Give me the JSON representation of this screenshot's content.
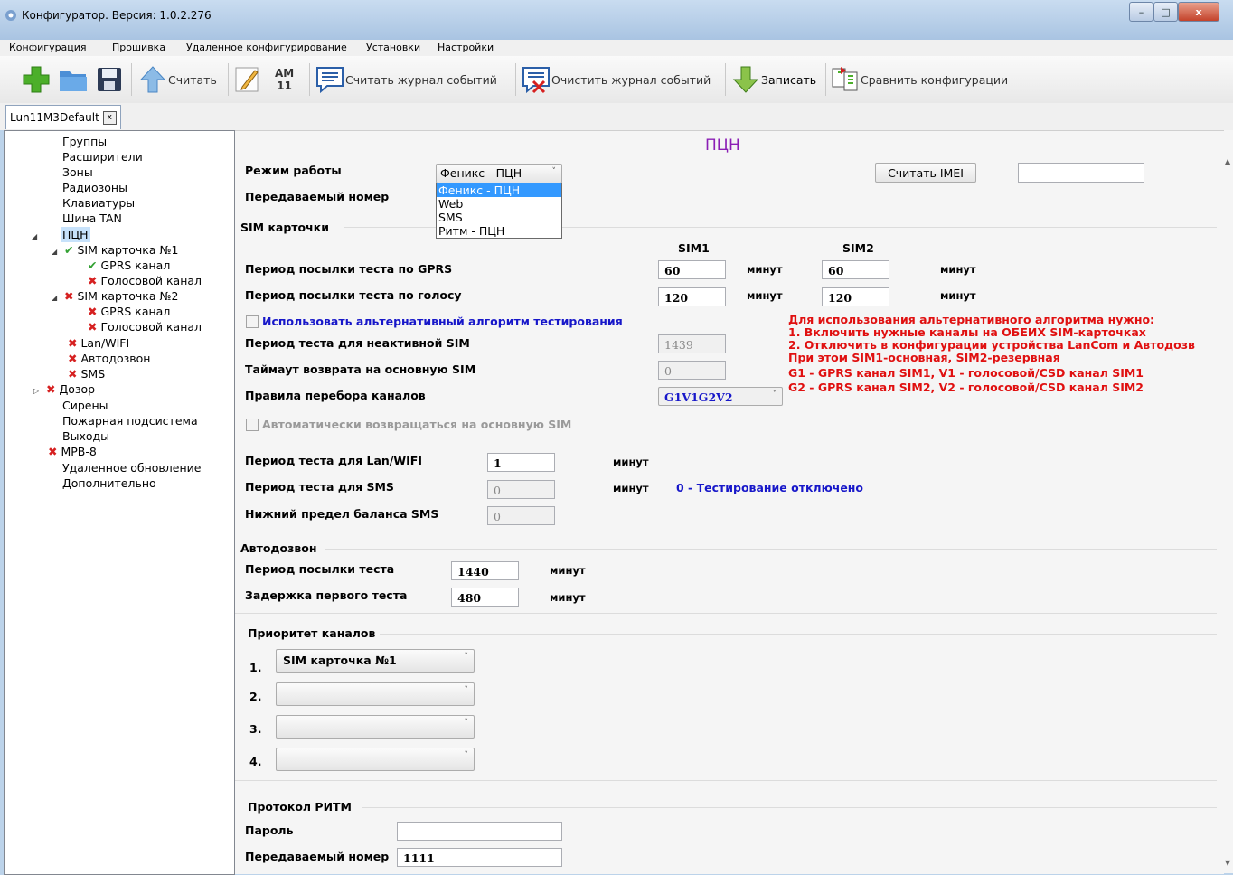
{
  "window": {
    "title": "Конфигуратор. Версия: 1.0.2.276",
    "min": "–",
    "max": "□",
    "close": "x"
  },
  "menu": [
    "Конфигурация",
    "Прошивка",
    "Удаленное конфигурирование",
    "Установки",
    "Настройки"
  ],
  "toolbar": {
    "read": "Считать",
    "am_top": "AM",
    "am_bottom": "11",
    "read_log": "Считать журнал событий",
    "clear_log": "Очистить журнал событий",
    "write": "Записать",
    "compare": "Сравнить конфигурации"
  },
  "tab": {
    "name": "Lun11M3Default",
    "close": "x"
  },
  "tree": [
    {
      "label": "Группы",
      "mark": ""
    },
    {
      "label": "Расширители",
      "mark": ""
    },
    {
      "label": "Зоны",
      "mark": ""
    },
    {
      "label": "Радиозоны",
      "mark": ""
    },
    {
      "label": "Клавиатуры",
      "mark": ""
    },
    {
      "label": "Шина TAN",
      "mark": ""
    },
    {
      "label": "ПЦН",
      "mark": ""
    },
    {
      "label": "SIM карточка №1",
      "mark": "✔"
    },
    {
      "label": "GPRS канал",
      "mark": "✔"
    },
    {
      "label": "Голосовой канал",
      "mark": "✖"
    },
    {
      "label": "SIM карточка №2",
      "mark": "✖"
    },
    {
      "label": "GPRS канал",
      "mark": "✖"
    },
    {
      "label": "Голосовой канал",
      "mark": "✖"
    },
    {
      "label": "Lan/WIFI",
      "mark": "✖"
    },
    {
      "label": "Автодозвон",
      "mark": "✖"
    },
    {
      "label": "SMS",
      "mark": "✖"
    },
    {
      "label": "Дозор",
      "mark": "✖"
    },
    {
      "label": "Сирены",
      "mark": ""
    },
    {
      "label": "Пожарная подсистема",
      "mark": ""
    },
    {
      "label": "Выходы",
      "mark": ""
    },
    {
      "label": "МРВ-8",
      "mark": "✖"
    },
    {
      "label": "Удаленное обновление",
      "mark": ""
    },
    {
      "label": "Дополнительно",
      "mark": ""
    }
  ],
  "page": {
    "title": "ПЦН",
    "mode_label": "Режим работы",
    "mode_value": "Феникс - ПЦН",
    "mode_options": [
      "Феникс - ПЦН",
      "Web",
      "SMS",
      "Ритм - ПЦН"
    ],
    "number_label": "Передаваемый номер",
    "read_imei": "Считать IMEI",
    "imei_value": "",
    "sim_section": "SIM карточки",
    "sim1": "SIM1",
    "sim2": "SIM2",
    "gprs_label": "Период посылки теста по GPRS",
    "gprs_sim1": "60",
    "gprs_sim2": "60",
    "voice_label": "Период посылки теста по голосу",
    "voice_sim1": "120",
    "voice_sim2": "120",
    "minutes": "минут",
    "alt_algo": "Использовать альтернативный алгоритм тестирования",
    "inactive_label": "Период теста для неактивной SIM",
    "inactive_value": "1439",
    "timeout_label": "Таймаут возврата на основную SIM",
    "timeout_value": "0",
    "rules_label": "Правила перебора каналов",
    "rules_value": "G1V1G2V2",
    "auto_return": "Автоматически возвращаться на основную SIM",
    "note": [
      "Для использования альтернативного алгоритма нужно:",
      "1. Включить нужные каналы на ОБЕИХ SIM-карточках",
      "2. Отключить в конфигурации устройства LanCom и Автодозв",
      "При этом SIM1-основная, SIM2-резервная",
      "G1 - GPRS канал SIM1, V1 - голосовой/CSD канал SIM1",
      "G2 - GPRS канал SIM2, V2 - голосовой/CSD канал SIM2"
    ],
    "lan_label": "Период теста для Lan/WIFI",
    "lan_value": "1",
    "sms_label": "Период теста для SMS",
    "sms_value": "0",
    "sms_note": "0 - Тестирование отключено",
    "sms_balance_label": "Нижний предел баланса SMS",
    "sms_balance_value": "0",
    "autodial_section": "Автодозвон",
    "autodial_period_label": "Период посылки теста",
    "autodial_period_value": "1440",
    "autodial_delay_label": "Задержка первого теста",
    "autodial_delay_value": "480",
    "priority_section": "Приоритет каналов",
    "priority": [
      {
        "num": "1.",
        "value": "SIM карточка №1"
      },
      {
        "num": "2.",
        "value": ""
      },
      {
        "num": "3.",
        "value": ""
      },
      {
        "num": "4.",
        "value": ""
      }
    ],
    "ritm_section": "Протокол РИТМ",
    "password_label": "Пароль",
    "password_value": "",
    "ritm_number_label": "Передаваемый номер",
    "ritm_number_value": "1111"
  }
}
